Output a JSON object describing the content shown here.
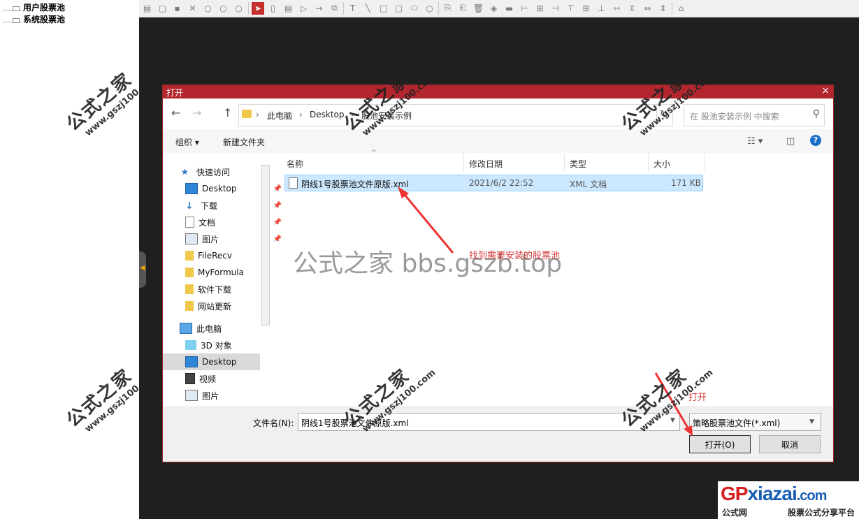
{
  "tree": {
    "items": [
      "用户股票池",
      "系统股票池"
    ]
  },
  "dialog": {
    "title": "打开",
    "close": "×",
    "nav": {
      "back": "←",
      "forward": "→",
      "up": "↑"
    },
    "address": {
      "crumbs": [
        "此电脑",
        "Desktop",
        "股池安装示例"
      ],
      "separator": "›"
    },
    "search_placeholder": "在 股池安装示例 中搜索",
    "commands": {
      "organize": "组织 ▾",
      "new_folder": "新建文件夹"
    },
    "nav_pane": [
      {
        "label": "快速访问",
        "icon": "star-icon"
      },
      {
        "label": "Desktop",
        "icon": "desktop-icon",
        "pinned": true
      },
      {
        "label": "下载",
        "icon": "download-icon",
        "pinned": true
      },
      {
        "label": "文档",
        "icon": "document-icon",
        "pinned": true
      },
      {
        "label": "图片",
        "icon": "picture-icon",
        "pinned": true
      },
      {
        "label": "FileRecv",
        "icon": "folder-icon"
      },
      {
        "label": "MyFormula",
        "icon": "folder-icon"
      },
      {
        "label": "软件下载",
        "icon": "folder-icon"
      },
      {
        "label": "网站更新",
        "icon": "folder-icon"
      },
      {
        "label": "此电脑",
        "icon": "computer-icon"
      },
      {
        "label": "3D 对象",
        "icon": "cube-icon"
      },
      {
        "label": "Desktop",
        "icon": "desktop-icon",
        "selected": true
      },
      {
        "label": "视频",
        "icon": "video-icon"
      },
      {
        "label": "图片",
        "icon": "picture-icon"
      }
    ],
    "columns": [
      "名称",
      "修改日期",
      "类型",
      "大小"
    ],
    "files": [
      {
        "name": "阴线1号股票池文件原版.xml",
        "modified": "2021/6/2 22:52",
        "type": "XML 文档",
        "size": "171 KB"
      }
    ],
    "filename_label": "文件名(N):",
    "filename_value": "阴线1号股票池文件原版.xml",
    "filter_value": "策略股票池文件(*.xml)",
    "open_label": "打开(O)",
    "cancel_label": "取消"
  },
  "annotations": {
    "find": "找到需要安装的股票池",
    "open": "打开"
  },
  "watermark_text": "公式之家 bbs.gszb.top",
  "stamp": {
    "title": "公式之家",
    "url": "www.gszj100.com"
  },
  "logo": {
    "brand": "GPxiazai.com",
    "tagline_left": "公式网",
    "tagline_right": "股票公式分享平台",
    "colors": {
      "gp": "#d42020",
      "xiazai": "#1a5fb4"
    }
  }
}
